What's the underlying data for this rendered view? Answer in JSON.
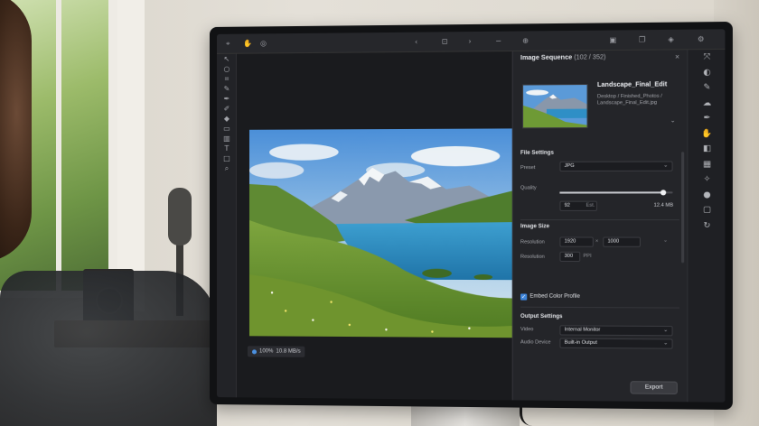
{
  "app": {
    "panel_title": "Image Sequence",
    "panel_count": "(102 / 352)",
    "zoom_status": "100%",
    "size_status": "10.8 MB/s"
  },
  "file": {
    "name": "Landscape_Final_Edit",
    "path": "Desktop / Finished_Photos / Landscape_Final_Edit.jpg"
  },
  "file_settings": {
    "heading": "File Settings",
    "format_label": "Preset",
    "format_value": "JPG",
    "quality_label": "Quality",
    "quality_value": "92",
    "quality_fraction": 0.92,
    "quality_unit": "Est.",
    "file_size": "12.4 MB"
  },
  "image_size": {
    "heading": "Image Size",
    "resolution_label": "Resolution",
    "width": "1920",
    "times": "×",
    "height": "1000",
    "res_label": "Resolution",
    "ppi_value": "300",
    "ppi_unit": "PPI",
    "embed_label": "Embed Color Profile"
  },
  "output": {
    "heading": "Output Settings",
    "video_label": "Video",
    "video_value": "Internal Monitor",
    "audio_label": "Audio Device",
    "audio_value": "Built-in Output"
  },
  "export_label": "Export",
  "colors": {
    "accent": "#3d84d9",
    "panel_bg": "#242529",
    "canvas_bg": "#1a1b1e"
  }
}
